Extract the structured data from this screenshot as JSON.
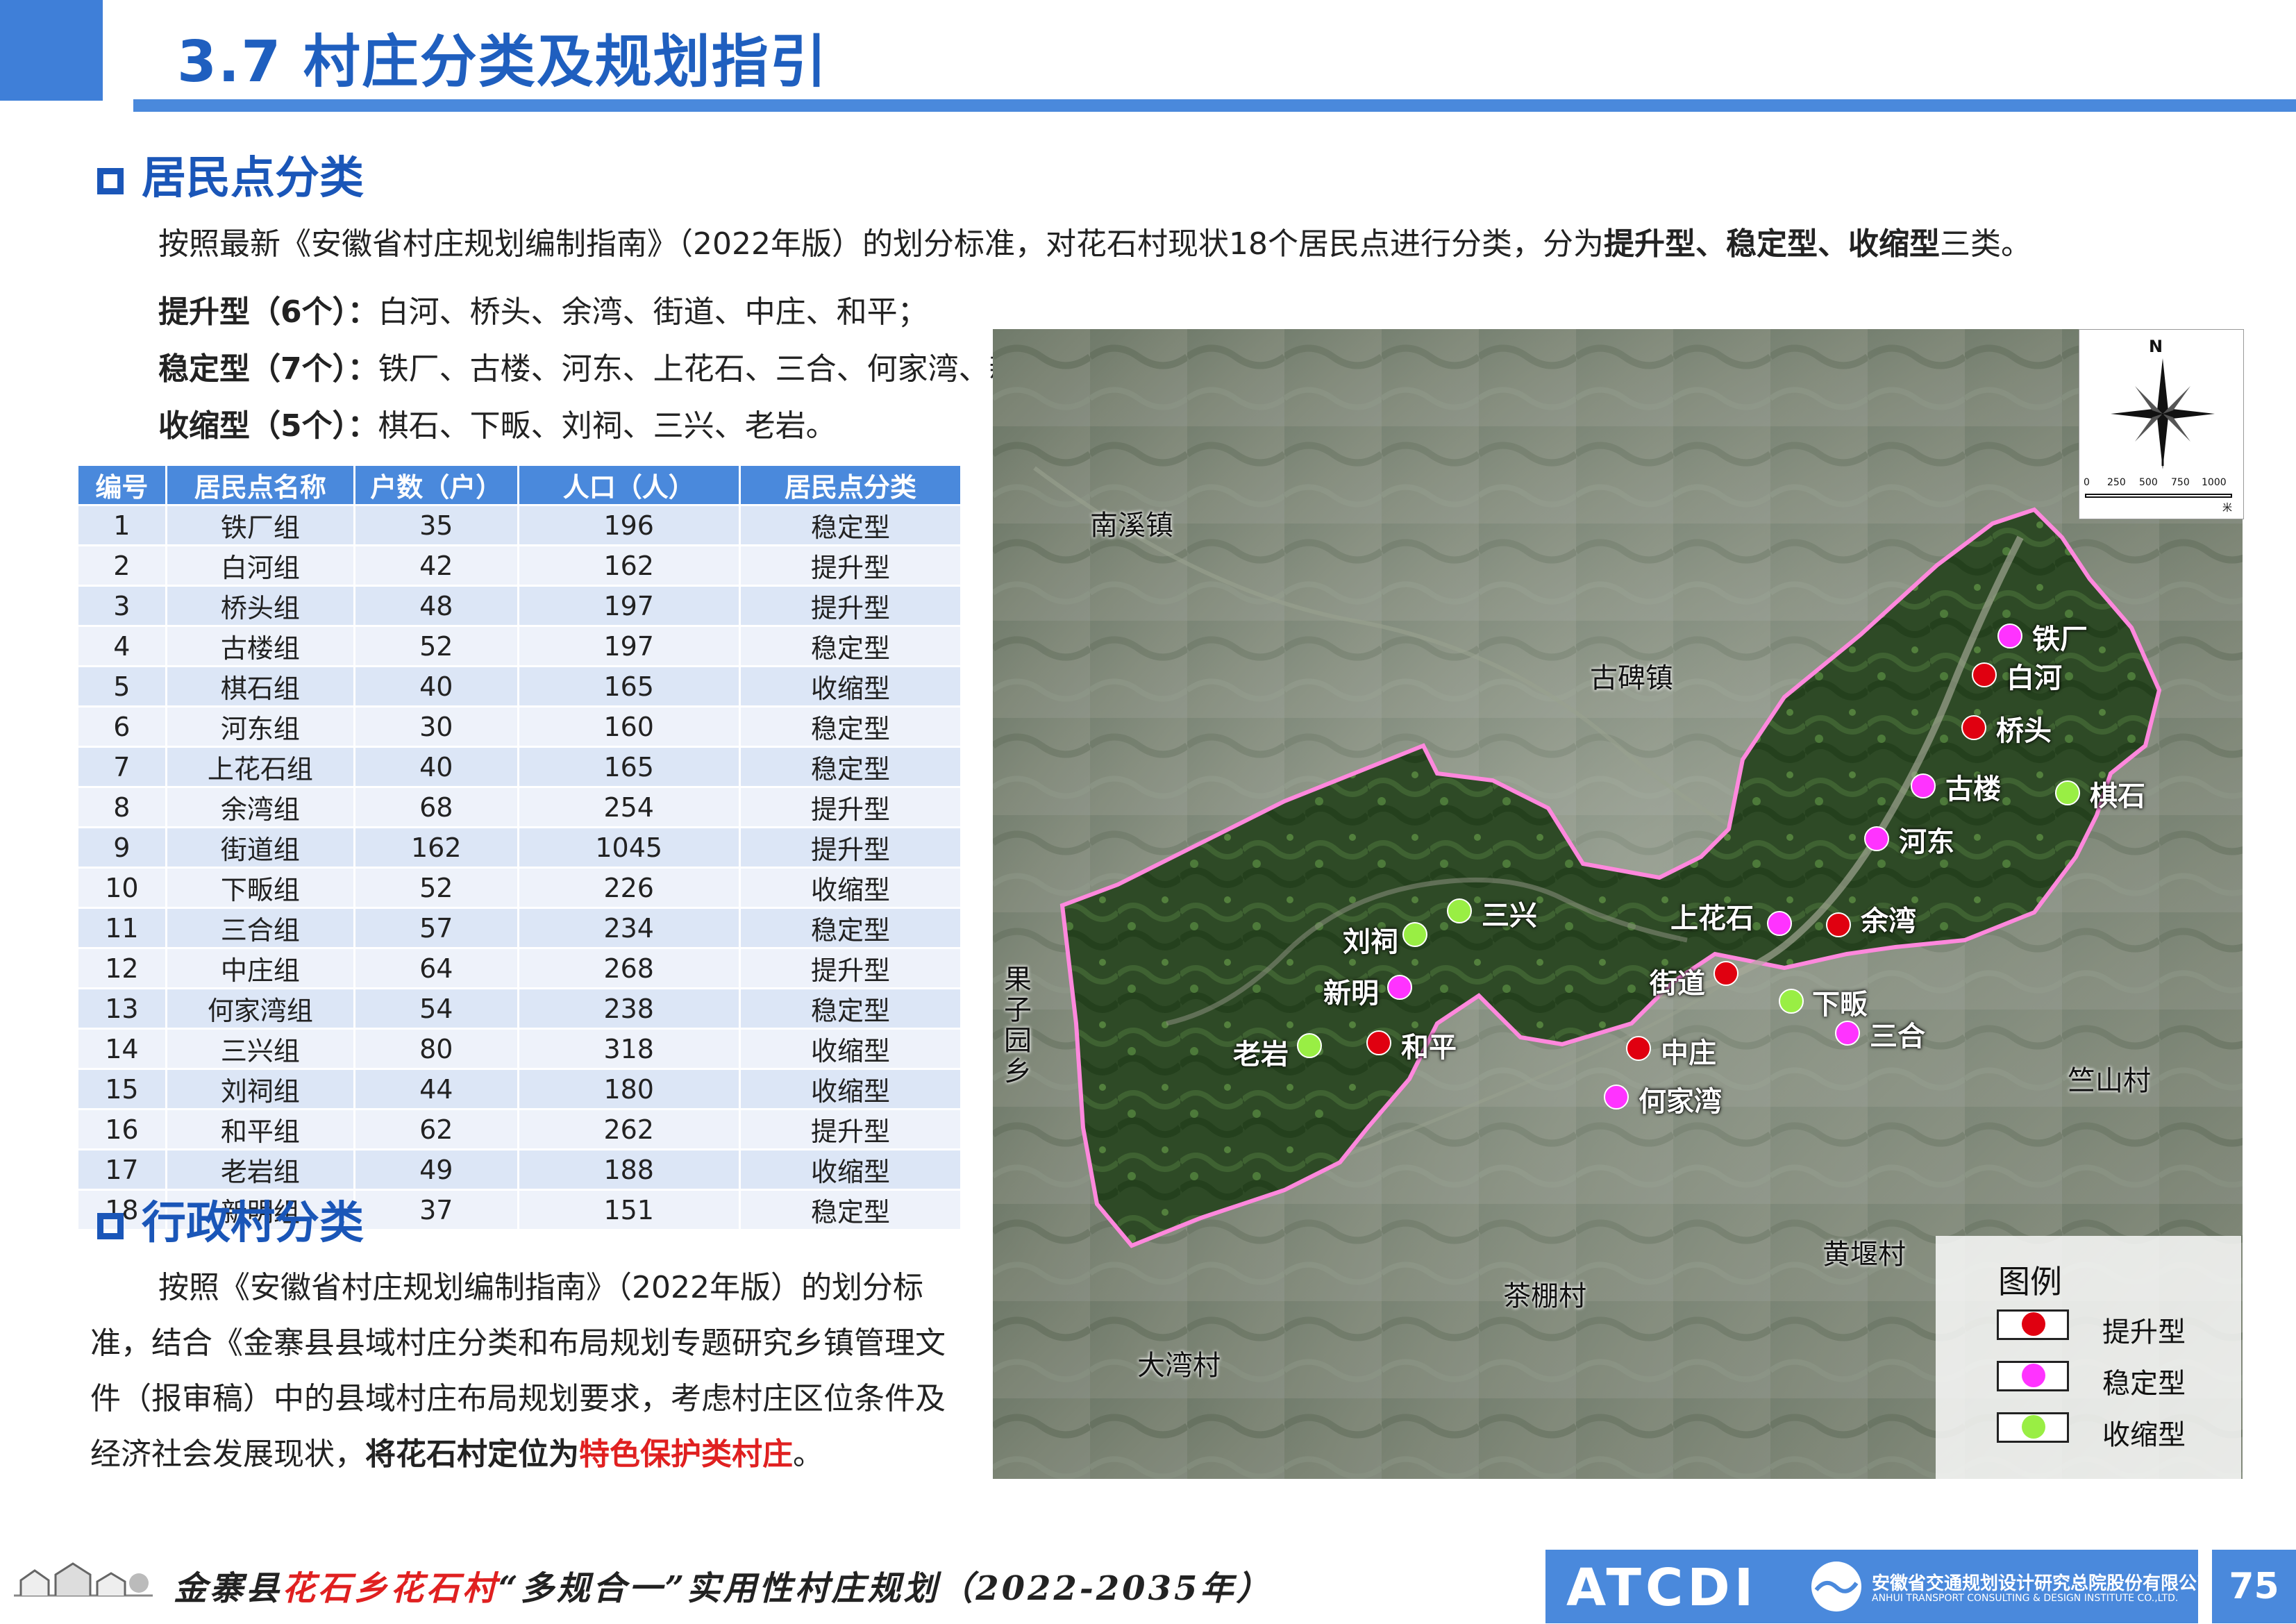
{
  "header": {
    "title": "3.7 村庄分类及规划指引"
  },
  "section1": {
    "title": "居民点分类",
    "intro_prefix": "按照最新《安徽省村庄规划编制指南》（2022年版）的划分标准，对花石村现状18个居民点进行分类，分为",
    "intro_bold": "提升型、稳定型、收缩型",
    "intro_suffix": "三类。",
    "types": [
      {
        "label": "提升型（6个）：",
        "items": "白河、桥头、余湾、街道、中庄、和平；"
      },
      {
        "label": "稳定型（7个）：",
        "items": "铁厂、古楼、河东、上花石、三合、何家湾、新明；"
      },
      {
        "label": "收缩型（5个）：",
        "items": "棋石、下畈、刘祠、三兴、老岩。"
      }
    ]
  },
  "table": {
    "headers": [
      "编号",
      "居民点名称",
      "户数（户）",
      "人口（人）",
      "居民点分类"
    ],
    "rows": [
      [
        "1",
        "铁厂组",
        "35",
        "196",
        "稳定型"
      ],
      [
        "2",
        "白河组",
        "42",
        "162",
        "提升型"
      ],
      [
        "3",
        "桥头组",
        "48",
        "197",
        "提升型"
      ],
      [
        "4",
        "古楼组",
        "52",
        "197",
        "稳定型"
      ],
      [
        "5",
        "棋石组",
        "40",
        "165",
        "收缩型"
      ],
      [
        "6",
        "河东组",
        "30",
        "160",
        "稳定型"
      ],
      [
        "7",
        "上花石组",
        "40",
        "165",
        "稳定型"
      ],
      [
        "8",
        "余湾组",
        "68",
        "254",
        "提升型"
      ],
      [
        "9",
        "街道组",
        "162",
        "1045",
        "提升型"
      ],
      [
        "10",
        "下畈组",
        "52",
        "226",
        "收缩型"
      ],
      [
        "11",
        "三合组",
        "57",
        "234",
        "稳定型"
      ],
      [
        "12",
        "中庄组",
        "64",
        "268",
        "提升型"
      ],
      [
        "13",
        "何家湾组",
        "54",
        "238",
        "稳定型"
      ],
      [
        "14",
        "三兴组",
        "80",
        "318",
        "收缩型"
      ],
      [
        "15",
        "刘祠组",
        "44",
        "180",
        "收缩型"
      ],
      [
        "16",
        "和平组",
        "62",
        "262",
        "提升型"
      ],
      [
        "17",
        "老岩组",
        "49",
        "188",
        "收缩型"
      ],
      [
        "18",
        "新明组",
        "37",
        "151",
        "稳定型"
      ]
    ]
  },
  "section2": {
    "title": "行政村分类",
    "para_prefix": "按照《安徽省村庄规划编制指南》（2022年版）的划分标准，结合《金寨县县域村庄分类和布局规划专题研究乡镇管理文件（报审稿）中的县域村庄布局规划要求，考虑村庄区位条件及经济社会发展现状，",
    "para_bold": "将花石村定位为",
    "para_red": "特色保护类村庄",
    "para_end": "。"
  },
  "map": {
    "towns": [
      "南溪镇",
      "古碑镇",
      "果子园乡",
      "竺山村",
      "黄堰村",
      "茶棚村",
      "大湾村"
    ],
    "points": [
      {
        "name": "铁厂",
        "type": "stable"
      },
      {
        "name": "白河",
        "type": "upgrade"
      },
      {
        "name": "桥头",
        "type": "upgrade"
      },
      {
        "name": "古楼",
        "type": "stable"
      },
      {
        "name": "棋石",
        "type": "shrink"
      },
      {
        "name": "河东",
        "type": "stable"
      },
      {
        "name": "上花石",
        "type": "stable"
      },
      {
        "name": "余湾",
        "type": "upgrade"
      },
      {
        "name": "街道",
        "type": "upgrade"
      },
      {
        "name": "下畈",
        "type": "shrink"
      },
      {
        "name": "三合",
        "type": "stable"
      },
      {
        "name": "中庄",
        "type": "upgrade"
      },
      {
        "name": "何家湾",
        "type": "stable"
      },
      {
        "name": "三兴",
        "type": "shrink"
      },
      {
        "name": "刘祠",
        "type": "shrink"
      },
      {
        "name": "新明",
        "type": "stable"
      },
      {
        "name": "和平",
        "type": "upgrade"
      },
      {
        "name": "老岩",
        "type": "shrink"
      }
    ],
    "legend": {
      "title": "图例",
      "items": [
        {
          "label": "提升型",
          "color": "#e00010"
        },
        {
          "label": "稳定型",
          "color": "#ff33ff"
        },
        {
          "label": "收缩型",
          "color": "#99ee44"
        }
      ]
    },
    "compass": {
      "north": "N",
      "scale": [
        "0",
        "250",
        "500",
        "750",
        "1000"
      ],
      "unit": "米"
    }
  },
  "footer": {
    "left": "金寨县",
    "mid": "花石乡花石村",
    "right": "“多规合一”实用性村庄规划（2022-2035年）",
    "org_logo": "ATCDI",
    "org_cn": "安徽省交通规划设计研究总院股份有限公司",
    "org_en": "ANHUI TRANSPORT CONSULTING & DESIGN INSTITUTE CO.,LTD.",
    "page": "75"
  }
}
